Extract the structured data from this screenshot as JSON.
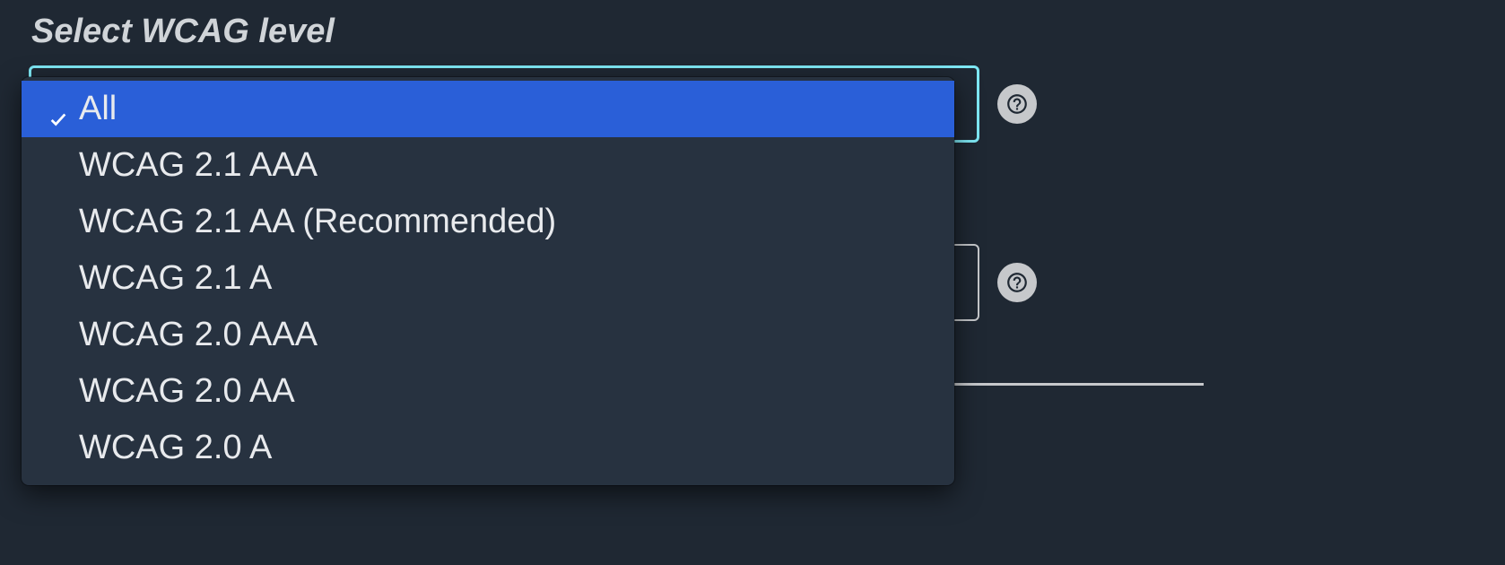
{
  "wcag_field": {
    "label": "Select WCAG level",
    "selected_index": 0,
    "options": [
      "All",
      "WCAG 2.1 AAA",
      "WCAG 2.1 AA (Recommended)",
      "WCAG 2.1 A",
      "WCAG 2.0 AAA",
      "WCAG 2.0 AA",
      "WCAG 2.0 A"
    ]
  }
}
